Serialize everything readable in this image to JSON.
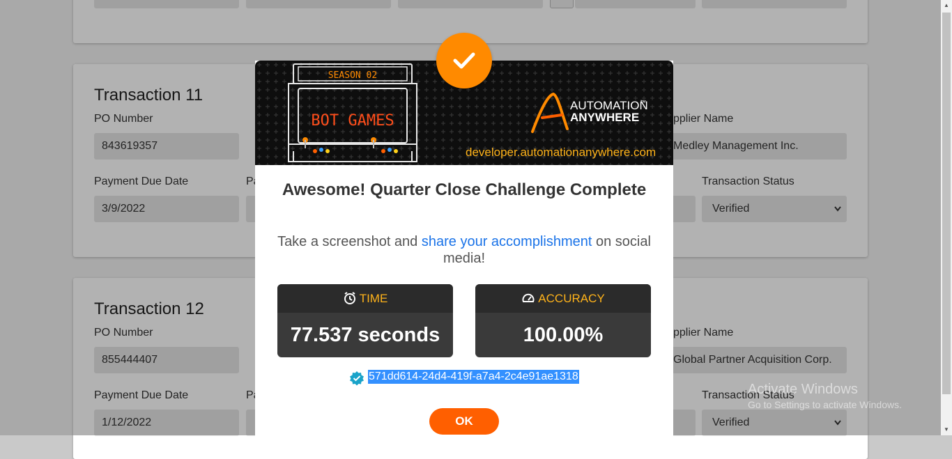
{
  "top_card": {
    "fields": [
      "",
      "",
      "",
      "",
      "",
      ""
    ]
  },
  "transactions": [
    {
      "title": "Transaction 11",
      "po_label": "PO Number",
      "po_value": "843619357",
      "supplier_label_visible": "pplier Name",
      "supplier_value": "Medley Management Inc.",
      "due_label": "Payment Due Date",
      "due_value": "3/9/2022",
      "partial_label": "Pa",
      "status_label": "Transaction Status",
      "status_value": "Verified"
    },
    {
      "title": "Transaction 12",
      "po_label": "PO Number",
      "po_value": "855444407",
      "supplier_label_visible": "pplier Name",
      "supplier_value": "Global Partner Acquisition Corp.",
      "due_label": "Payment Due Date",
      "due_value": "1/12/2022",
      "partial_label": "Pa",
      "status_label": "Transaction Status",
      "status_value": "Verified"
    }
  ],
  "modal": {
    "banner": {
      "season": "SEASON 02",
      "game_title": "BOT GAMES",
      "brand_line1": "AUTOMATION",
      "brand_tm": "™",
      "brand_line2": "ANYWHERE",
      "website": "developer.automationanywhere.com"
    },
    "title": "Awesome! Quarter Close Challenge Complete",
    "subtitle_pre": "Take a screenshot and ",
    "subtitle_link": "share your accomplishment",
    "subtitle_post": " on social media!",
    "time_label": "TIME",
    "time_value": "77.537 seconds",
    "accuracy_label": "ACCURACY",
    "accuracy_value": "100.00%",
    "certificate_id": "571dd614-24d4-419f-a7a4-2c4e91ae1318",
    "ok_label": "OK"
  },
  "watermark": {
    "line1": "Activate Windows",
    "line2": "Go to Settings to activate Windows."
  },
  "colors": {
    "accent_orange": "#ff8a00",
    "ok_button": "#ff5f00",
    "stat_label": "#ffb31a",
    "link": "#1a73e8",
    "selection": "#3390ff"
  },
  "icons": [
    "checkmark-icon",
    "alarm-clock-icon",
    "speedometer-icon",
    "verified-badge-icon",
    "chevron-down-icon",
    "automation-anywhere-logo"
  ]
}
